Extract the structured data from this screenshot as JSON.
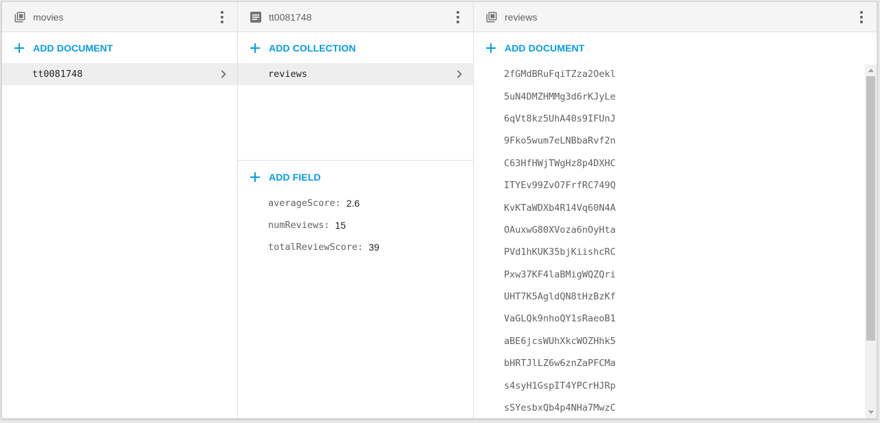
{
  "colors": {
    "accent": "#039be5",
    "header_bg": "#f5f5f5",
    "selected_bg": "#eeeeee"
  },
  "panel_movies": {
    "title": "movies",
    "icon": "collection-icon",
    "action_label": "ADD DOCUMENT",
    "items": [
      {
        "label": "tt0081748",
        "selected": true
      }
    ]
  },
  "panel_document": {
    "title": "tt0081748",
    "icon": "document-icon",
    "collection_action_label": "ADD COLLECTION",
    "collections": [
      {
        "label": "reviews",
        "selected": true
      }
    ],
    "field_action_label": "ADD FIELD",
    "fields": [
      {
        "key": "averageScore",
        "value": "2.6"
      },
      {
        "key": "numReviews",
        "value": "15"
      },
      {
        "key": "totalReviewScore",
        "value": "39"
      }
    ]
  },
  "panel_reviews": {
    "title": "reviews",
    "icon": "collection-icon",
    "action_label": "ADD DOCUMENT",
    "documents": [
      "2fGMdBRuFqiTZza2Oekl",
      "5uN4DMZHMMg3d6rKJyLe",
      "6qVt8kz5UhA40s9IFUnJ",
      "9Fko5wum7eLNBbaRvf2n",
      "C63HfHWjTWgHz8p4DXHC",
      "ITYEv99ZvO7FrfRC749Q",
      "KvKTaWDXb4R14Vq60N4A",
      "OAuxwG80XVoza6nOyHta",
      "PVd1hKUK35bjKiishcRC",
      "Pxw37KF4laBMigWQZQri",
      "UHT7K5AgldQN8tHzBzKf",
      "VaGLQk9nhoQY1sRaeoB1",
      "aBE6jcsWUhXkcWOZHhk5",
      "bHRTJlLZ6w6znZaPFCMa",
      "s4syH1GspIT4YPCrHJRp",
      "sSYesbxQb4p4NHa7MwzC"
    ]
  }
}
